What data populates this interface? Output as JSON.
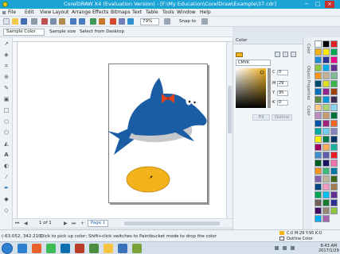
{
  "window": {
    "title": "CorelDRAW X4 (Evaluation Version) - [F:\\My Education\\CorelDraw\\Example\\37.cdr]",
    "minimize_glyph": "−",
    "maximize_glyph": "□",
    "close_glyph": "×"
  },
  "menu": [
    {
      "id": "file",
      "label": "File"
    },
    {
      "id": "edit",
      "label": "Edit"
    },
    {
      "id": "view",
      "label": "View"
    },
    {
      "id": "layout",
      "label": "Layout"
    },
    {
      "id": "arrange",
      "label": "Arrange"
    },
    {
      "id": "effects",
      "label": "Effects"
    },
    {
      "id": "bitmaps",
      "label": "Bitmaps"
    },
    {
      "id": "text",
      "label": "Text"
    },
    {
      "id": "table",
      "label": "Table"
    },
    {
      "id": "tools",
      "label": "Tools"
    },
    {
      "id": "window",
      "label": "Window"
    },
    {
      "id": "help",
      "label": "Help"
    }
  ],
  "standard_toolbar": {
    "zoom": "79%",
    "snap_to": "Snap to"
  },
  "property_bar": {
    "mode": "Sample Color",
    "sample_size": "Sample size",
    "select_from_desktop": "Select from Desktop"
  },
  "page_nav": {
    "first": "⏮",
    "prev": "◀",
    "counter": "1 of 1",
    "next": "▶",
    "last": "⏭",
    "add": "+",
    "page_tab": "Page 1"
  },
  "color_docker": {
    "title": "Color",
    "current_color": "#f2b21b",
    "model": "CMYK",
    "fields": [
      {
        "name": "C",
        "value": "0"
      },
      {
        "name": "M",
        "value": "29"
      },
      {
        "name": "Y",
        "value": "95"
      },
      {
        "name": "K",
        "value": "0"
      }
    ],
    "fill_button": "Fill",
    "outline_button": "Outline"
  },
  "docker_tabs": [
    "Color",
    "Object Properties",
    "Color"
  ],
  "status": {
    "coords": "(-63.052, 342.210)",
    "hint": "Click to pick up color; Shift+click switches to Paintbucket mode to drop the color",
    "fill_swatch": "#f2b21b",
    "fill_info": "C:0 M:29 Y:95 K:0",
    "outline_label": "Outline Color"
  },
  "taskbar": {
    "time": "8:43 AM",
    "date": "2017/1/29"
  },
  "palette_colors": [
    "#ffffff",
    "#000000",
    "#e31f26",
    "#f2b21b",
    "#ffe900",
    "#00a651",
    "#1f8dd6",
    "#2e3192",
    "#ec008c",
    "#8dc63f",
    "#00aeef",
    "#662d91",
    "#f7941d",
    "#c7b299",
    "#7fbb8f",
    "#004b6b",
    "#d9e021",
    "#39b54a",
    "#0072bc",
    "#92278f",
    "#a0410d",
    "#5c8a45",
    "#0095da",
    "#3d2b56",
    "#fdc689",
    "#acd373",
    "#8ad3e8",
    "#bd8cbf",
    "#c69c6d",
    "#007236",
    "#0054a6",
    "#a3217c",
    "#f26522",
    "#00a99d",
    "#6dcff6",
    "#8781bd",
    "#fff200",
    "#007a4a",
    "#003663",
    "#9e005d",
    "#fbaf5d",
    "#1ab39f",
    "#448ccb",
    "#605ca8",
    "#ed1c24",
    "#005e20",
    "#1b1464",
    "#f06eaa",
    "#f7941d",
    "#3cb878",
    "#0076a3",
    "#8560a8",
    "#c2b59b",
    "#406618",
    "#00467f",
    "#f49ac2",
    "#a67c52",
    "#00a651",
    "#00bff3",
    "#662d91",
    "#736357",
    "#197b30",
    "#2e3192",
    "#440e62",
    "#998675",
    "#8dc63f",
    "#00aeef",
    "#a864a8"
  ]
}
